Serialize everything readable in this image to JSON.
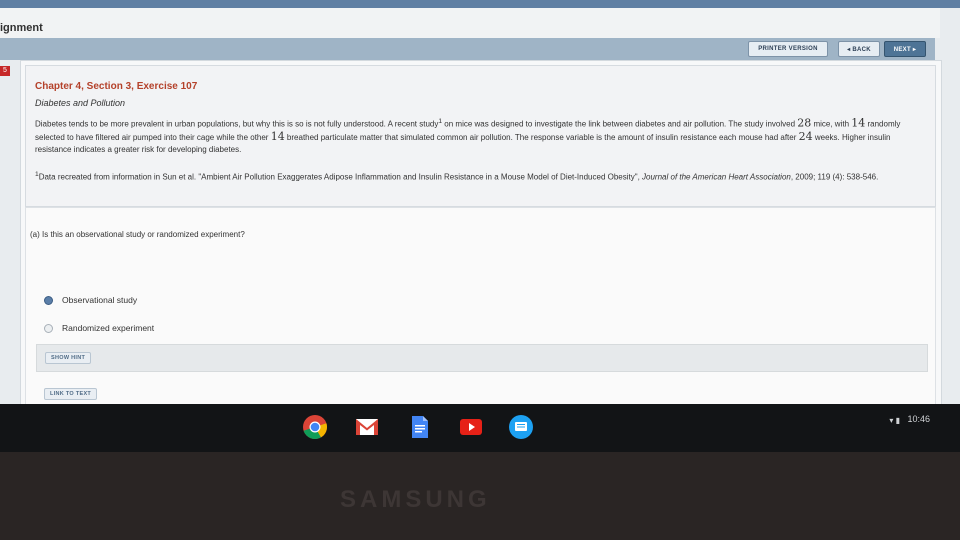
{
  "header": {
    "title": "ignment"
  },
  "nav": {
    "printer": "PRINTER VERSION",
    "back": "◂ BACK",
    "next": "NEXT ▸"
  },
  "leftnum": "5",
  "problem": {
    "title": "Chapter 4, Section 3, Exercise 107",
    "subtitle": "Diabetes and Pollution",
    "p1": "Diabetes tends to be more prevalent in urban populations, but why this is so is not fully understood. A recent study",
    "sup1": "1",
    "p2": " on mice was designed to investigate the link between diabetes and air pollution. The study involved ",
    "n1": "28",
    "p3": " mice, with ",
    "n2": "14",
    "p4": " randomly selected to have filtered air pumped into their cage while the other ",
    "n3": "14",
    "p5": " breathed particulate matter that simulated common air pollution. The response variable is the amount of insulin resistance each mouse had after ",
    "n4": "24",
    "p6": " weeks. Higher insulin resistance indicates a greater risk for developing diabetes.",
    "foot_sup": "1",
    "foot_text": "Data recreated from information in Sun et al. \"Ambient Air Pollution Exaggerates Adipose Inflammation and Insulin Resistance in a Mouse Model of Diet-Induced Obesity\", ",
    "foot_journal": "Journal of the American Heart Association",
    "foot_end": ", 2009; 119 (4): 538-546."
  },
  "question": {
    "text": "(a) Is this an observational study or randomized experiment?",
    "options": [
      "Observational study",
      "Randomized experiment"
    ],
    "selected": "Observational study"
  },
  "buttons": {
    "hint": "SHOW HINT",
    "link": "LINK TO TEXT"
  },
  "shelf": {
    "apps": [
      "chrome-icon",
      "gmail-icon",
      "docs-icon",
      "youtube-icon",
      "messages-icon"
    ],
    "time": "10:46",
    "status": "▾ ▮"
  },
  "bezel": {
    "logo": "SAMSUNG"
  }
}
